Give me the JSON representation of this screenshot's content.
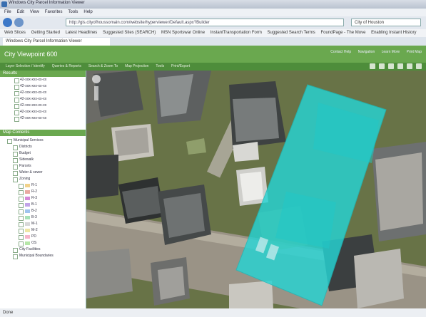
{
  "browser": {
    "window_title": "Windows City Parcel Information Viewer",
    "menu": [
      "File",
      "Edit",
      "View",
      "Favorites",
      "Tools",
      "Help"
    ],
    "address": "http://gis.cityofhoussomain.com/website/hyperviewer/Default.aspx?Builder",
    "search_placeholder": "City of Houston",
    "favorites": [
      "Web Slices",
      "Getting Started",
      "Latest Headlines",
      "Suggested Sites (SEARCH)",
      "MSN Sportswar Online",
      "InstantTransportation Form",
      "Suggested Search Terms",
      "FoundPage - The Move",
      "Enabling Instant History"
    ],
    "tab_label": "Windows City Parcel Information Viewer"
  },
  "app": {
    "title": "City Viewpoint 600",
    "header_links": [
      "Contact Help",
      "Navigation",
      "Learn More",
      "Print Map"
    ],
    "toolbar_items": [
      "Layer Selection / Identify",
      "Queries & Reports",
      "Search & Zoom To",
      "Map Projection",
      "Tools",
      "Print/Export"
    ]
  },
  "layers_panel": {
    "title": "Results",
    "items": [
      "42-xxx-xxx-xx-xx",
      "42-xxx-xxx-xx-xx",
      "42-xxx-xxx-xx-xx",
      "42-xxx-xxx-xx-xx",
      "42-xxx-xxx-xx-xx",
      "42-xxx-xxx-xx-xx",
      "42-xxx-xxx-xx-xx"
    ]
  },
  "contents_panel": {
    "title": "Map Contents",
    "nodes": [
      {
        "label": "Municipal Services",
        "indent": 0
      },
      {
        "label": "Districts",
        "indent": 1
      },
      {
        "label": "Budget",
        "indent": 1
      },
      {
        "label": "Sidewalk",
        "indent": 1
      },
      {
        "label": "Parcels",
        "indent": 1
      },
      {
        "label": "Water & sewer",
        "indent": 1
      },
      {
        "label": "Zoning",
        "indent": 1
      },
      {
        "label": "R-1",
        "indent": 2,
        "swatch": "#f1d28a"
      },
      {
        "label": "R-2",
        "indent": 2,
        "swatch": "#e9a9a1"
      },
      {
        "label": "R-3",
        "indent": 2,
        "swatch": "#d58ad8"
      },
      {
        "label": "B-1",
        "indent": 2,
        "swatch": "#c2a4e8"
      },
      {
        "label": "B-2",
        "indent": 2,
        "swatch": "#9fc4ef"
      },
      {
        "label": "B-3",
        "indent": 2,
        "swatch": "#a7e2b8"
      },
      {
        "label": "M-1",
        "indent": 2,
        "swatch": "#d8d8d8"
      },
      {
        "label": "M-2",
        "indent": 2,
        "swatch": "#efe6a4"
      },
      {
        "label": "PD",
        "indent": 2,
        "swatch": "#f6b5c9"
      },
      {
        "label": "OS",
        "indent": 2,
        "swatch": "#b5e6a7"
      },
      {
        "label": "City Facilities",
        "indent": 1
      },
      {
        "label": "Municipal Boundaries",
        "indent": 1
      }
    ]
  },
  "map": {
    "highlight_color": "#26d4d4",
    "selected_parcel": "highlighted"
  },
  "status": {
    "text": "Done"
  }
}
